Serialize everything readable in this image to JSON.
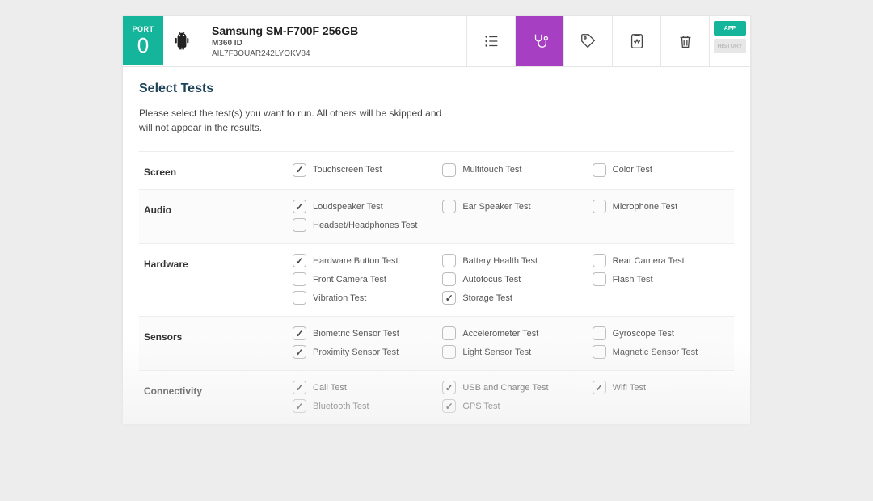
{
  "header": {
    "port_label": "PORT",
    "port_number": "0",
    "device_title": "Samsung SM-F700F 256GB",
    "device_subtitle": "M360 ID",
    "device_id": "AIL7F3OUAR242LYOKV84",
    "btn_app": "APP",
    "btn_history": "HISTORY"
  },
  "page": {
    "title": "Select Tests",
    "intro": "Please select the test(s) you want to run. All others will be skipped and will not appear in the results."
  },
  "categories": [
    {
      "label": "Screen",
      "tests": [
        {
          "label": "Touchscreen Test",
          "checked": true
        },
        {
          "label": "Multitouch Test",
          "checked": false
        },
        {
          "label": "Color Test",
          "checked": false
        }
      ]
    },
    {
      "label": "Audio",
      "tests": [
        {
          "label": "Loudspeaker Test",
          "checked": true
        },
        {
          "label": "Ear Speaker Test",
          "checked": false
        },
        {
          "label": "Microphone Test",
          "checked": false
        },
        {
          "label": "Headset/Headphones Test",
          "checked": false
        }
      ]
    },
    {
      "label": "Hardware",
      "tests": [
        {
          "label": "Hardware Button Test",
          "checked": true
        },
        {
          "label": "Battery Health Test",
          "checked": false
        },
        {
          "label": "Rear Camera Test",
          "checked": false
        },
        {
          "label": "Front Camera Test",
          "checked": false
        },
        {
          "label": "Autofocus Test",
          "checked": false
        },
        {
          "label": "Flash Test",
          "checked": false
        },
        {
          "label": "Vibration Test",
          "checked": false
        },
        {
          "label": "Storage Test",
          "checked": true
        }
      ]
    },
    {
      "label": "Sensors",
      "tests": [
        {
          "label": "Biometric Sensor Test",
          "checked": true
        },
        {
          "label": "Accelerometer Test",
          "checked": false
        },
        {
          "label": "Gyroscope Test",
          "checked": false
        },
        {
          "label": "Proximity Sensor Test",
          "checked": true
        },
        {
          "label": "Light Sensor Test",
          "checked": false
        },
        {
          "label": "Magnetic Sensor Test",
          "checked": false
        }
      ]
    },
    {
      "label": "Connectivity",
      "tests": [
        {
          "label": "Call Test",
          "checked": true
        },
        {
          "label": "USB and Charge Test",
          "checked": true
        },
        {
          "label": "Wifi Test",
          "checked": true
        },
        {
          "label": "Bluetooth Test",
          "checked": true
        },
        {
          "label": "GPS Test",
          "checked": true
        }
      ]
    }
  ]
}
